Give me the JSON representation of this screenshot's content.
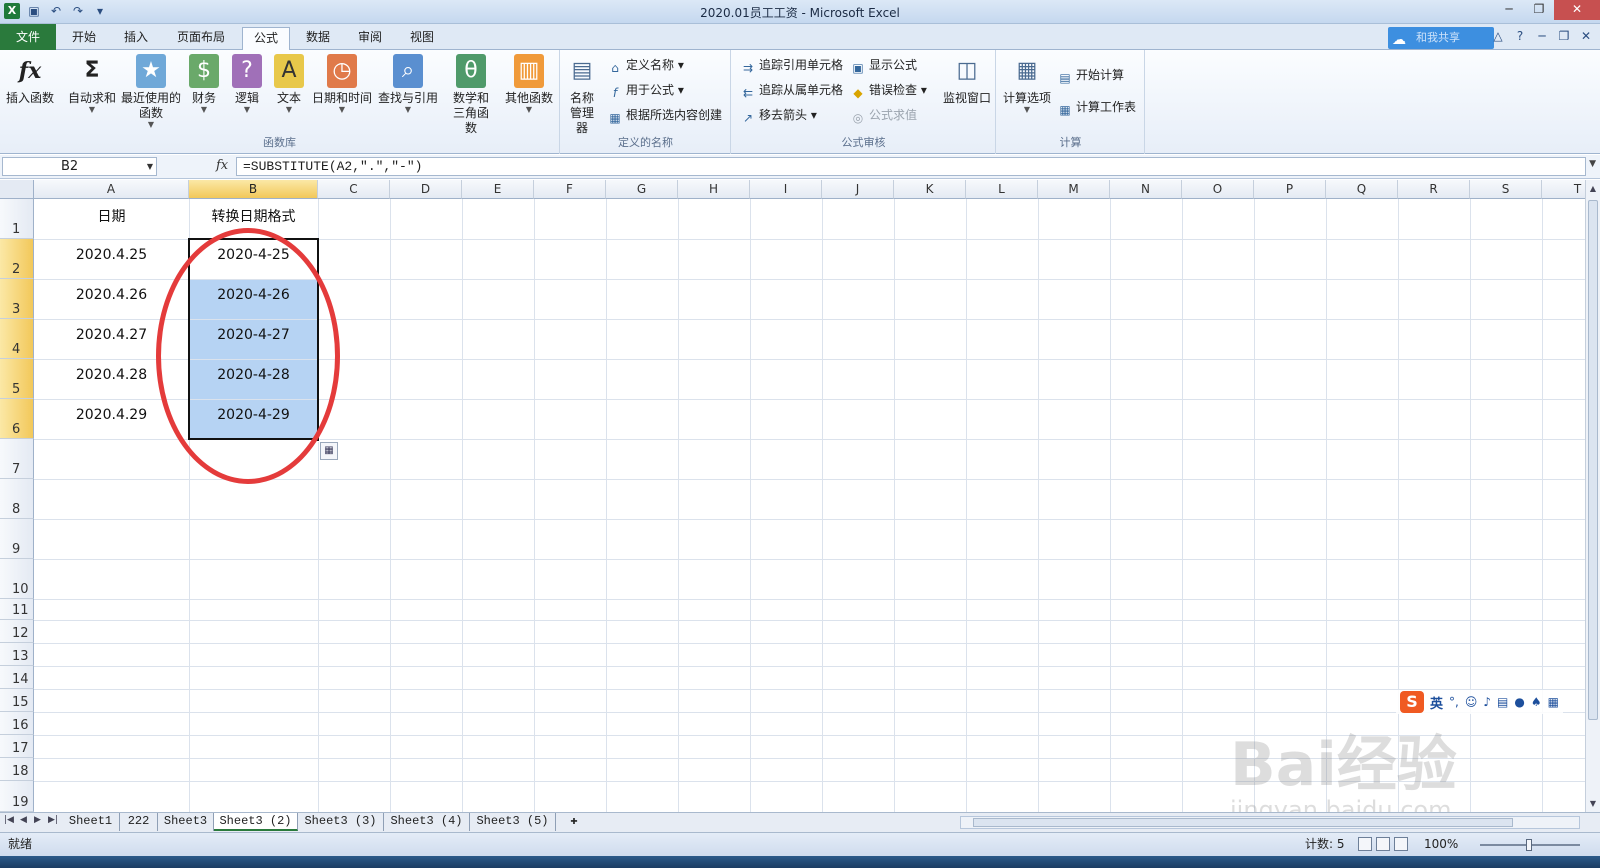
{
  "window": {
    "title": "2020.01员工工资 - Microsoft Excel"
  },
  "ribbon_tabs": [
    "文件",
    "开始",
    "插入",
    "页面布局",
    "公式",
    "数据",
    "审阅",
    "视图"
  ],
  "active_tab": "公式",
  "cloud_button": "和我共享",
  "groups": {
    "function_library": {
      "label": "函数库",
      "buttons": [
        "插入函数",
        "自动求和",
        "最近使用的函数",
        "财务",
        "逻辑",
        "文本",
        "日期和时间",
        "查找与引用",
        "数学和三角函数",
        "其他函数"
      ]
    },
    "defined_names": {
      "label": "定义的名称",
      "name_manager": "名称管理器",
      "define_name": "定义名称",
      "use_in_formula": "用于公式",
      "create_from_selection": "根据所选内容创建"
    },
    "formula_auditing": {
      "label": "公式审核",
      "trace_precedents": "追踪引用单元格",
      "trace_dependents": "追踪从属单元格",
      "remove_arrows": "移去箭头",
      "show_formulas": "显示公式",
      "error_checking": "错误检查",
      "evaluate_formula": "公式求值",
      "watch_window": "监视窗口"
    },
    "calculation": {
      "label": "计算",
      "calc_options": "计算选项",
      "calc_now": "开始计算",
      "calc_sheet": "计算工作表"
    }
  },
  "formula_bar": {
    "name_box": "B2",
    "formula": "=SUBSTITUTE(A2,\".\",\"-\")"
  },
  "columns": [
    "A",
    "B",
    "C",
    "D",
    "E",
    "F",
    "G",
    "H",
    "I",
    "J",
    "K",
    "L",
    "M",
    "N",
    "O",
    "P",
    "Q",
    "R",
    "S",
    "T"
  ],
  "rows": [
    "1",
    "2",
    "3",
    "4",
    "5",
    "6",
    "7",
    "8",
    "9",
    "10",
    "11",
    "12",
    "13",
    "14",
    "15",
    "16",
    "17",
    "18",
    "19"
  ],
  "cells": {
    "A1": "日期",
    "B1": "转换日期格式",
    "A": [
      "2020.4.25",
      "2020.4.26",
      "2020.4.27",
      "2020.4.28",
      "2020.4.29"
    ],
    "B": [
      "2020-4-25",
      "2020-4-26",
      "2020-4-27",
      "2020-4-28",
      "2020-4-29"
    ]
  },
  "sheet_tabs": [
    "Sheet1",
    "222",
    "Sheet3",
    "Sheet3 (2)",
    "Sheet3 (3)",
    "Sheet3 (4)",
    "Sheet3 (5)"
  ],
  "active_sheet": "Sheet3 (2)",
  "status": {
    "ready": "就绪",
    "count": "计数: 5",
    "zoom": "100%"
  },
  "ime": {
    "logo": "S",
    "mode": "英"
  },
  "watermark": {
    "brand": "Bai经验",
    "url": "jingyan.baidu.com"
  },
  "colors": {
    "file_tab": "#2a7a3c",
    "selection": "#b6d3f3",
    "annotation_circle": "#e43b3b",
    "header_selected": "#f2c85a"
  }
}
